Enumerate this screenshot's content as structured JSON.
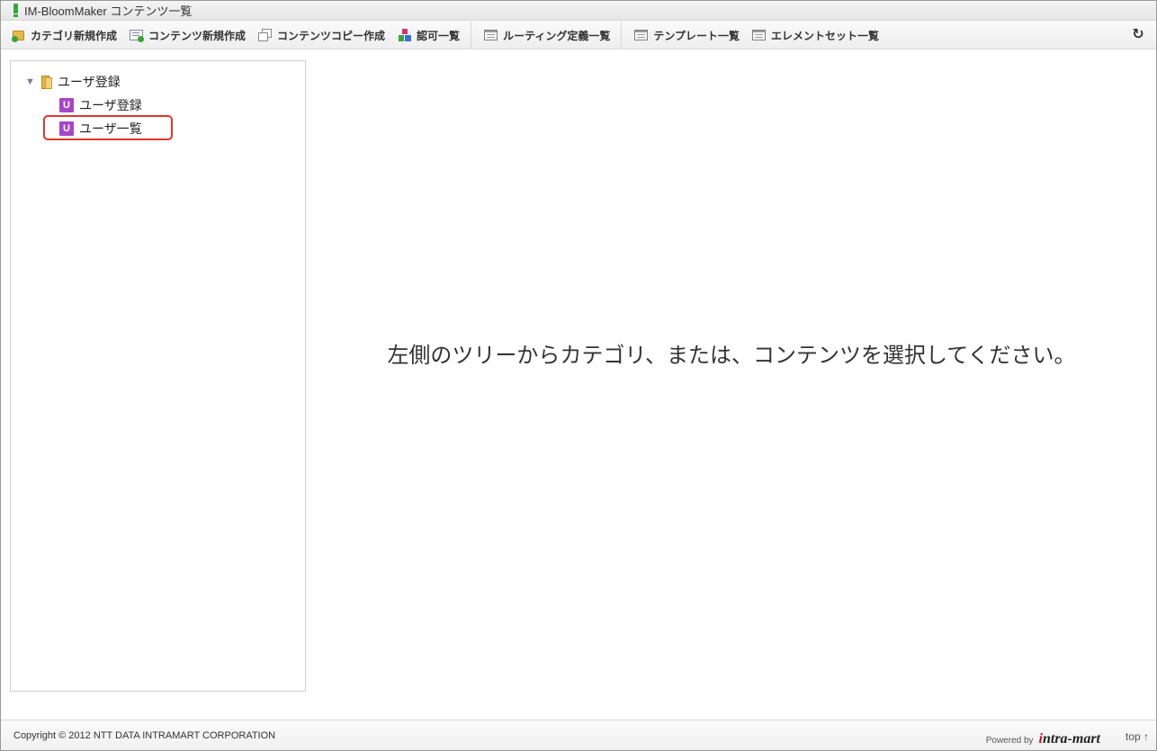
{
  "window": {
    "title": "IM-BloomMaker コンテンツ一覧"
  },
  "toolbar": {
    "items": [
      {
        "label": "カテゴリ新規作成",
        "icon": "folder-add-icon"
      },
      {
        "label": "コンテンツ新規作成",
        "icon": "document-add-icon"
      },
      {
        "label": "コンテンツコピー作成",
        "icon": "copy-icon"
      },
      {
        "label": "認可一覧",
        "icon": "authorization-icon"
      },
      {
        "label": "ルーティング定義一覧",
        "icon": "list-window-icon"
      },
      {
        "label": "テンプレート一覧",
        "icon": "list-window-icon"
      },
      {
        "label": "エレメントセット一覧",
        "icon": "list-window-icon"
      }
    ],
    "refresh_icon": "refresh-icon",
    "refresh_glyph": "↻"
  },
  "tree": {
    "root": {
      "label": "ユーザ登録",
      "expanded": true,
      "toggle_glyph": "▼"
    },
    "children": [
      {
        "label": "ユーザ登録",
        "badge": "U"
      },
      {
        "label": "ユーザ一覧",
        "badge": "U",
        "highlighted": true
      }
    ]
  },
  "main": {
    "message": "左側のツリーからカテゴリ、または、コンテンツを選択してください。"
  },
  "footer": {
    "copyright": "Copyright © 2012 NTT DATA INTRAMART CORPORATION",
    "powered_by": "Powered by",
    "logo_text_i": "i",
    "logo_text_rest": "ntra-mart",
    "top_link": "top ↑"
  },
  "colors": {
    "highlight_border": "#e0362b",
    "content_badge": "#a646c8",
    "logo_accent": "#c8102e"
  }
}
